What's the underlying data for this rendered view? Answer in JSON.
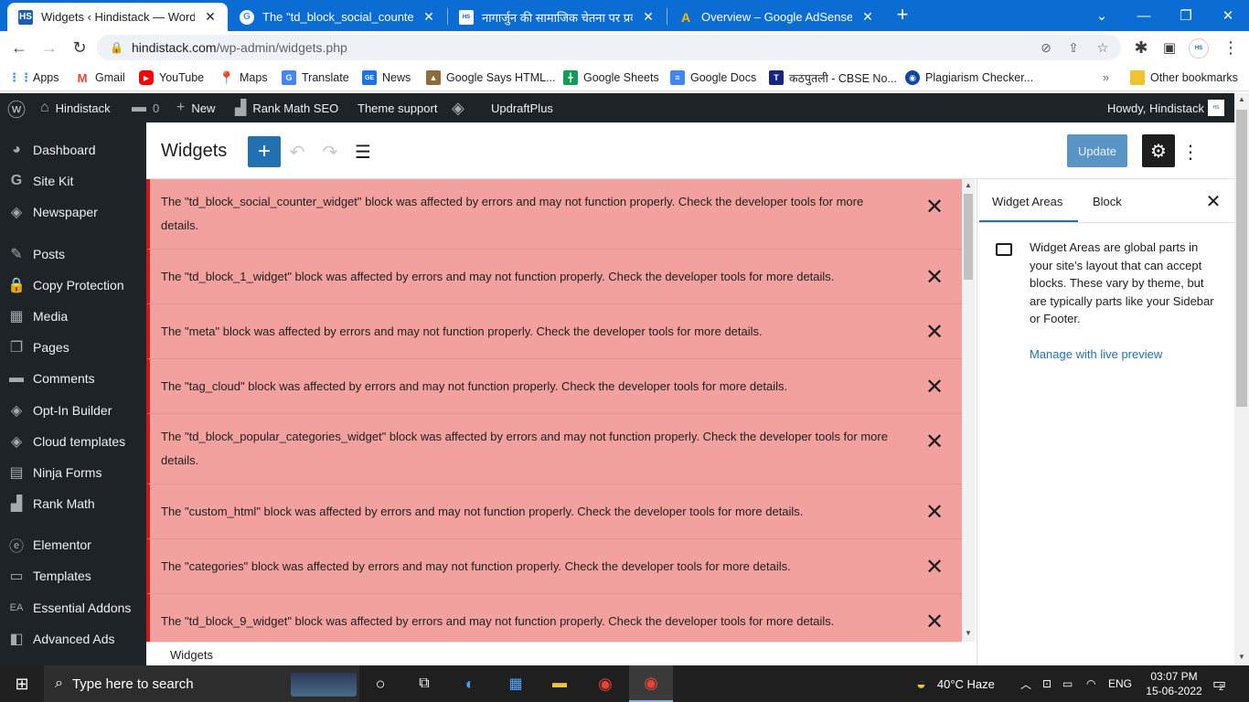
{
  "browser": {
    "tabs": [
      {
        "title": "Widgets ‹ Hindistack — WordPress",
        "favicon": "HS",
        "active": true
      },
      {
        "title": "The \"td_block_social_counter_widget\"",
        "favicon": "G",
        "active": false
      },
      {
        "title": "नागार्जुन की सामाजिक चेतना पर प्रकाश",
        "favicon": "HS",
        "active": false
      },
      {
        "title": "Overview – Google AdSense",
        "favicon": "A",
        "active": false
      }
    ],
    "url_host": "hindistack.com",
    "url_path": "/wp-admin/widgets.php",
    "profile_label": "HS",
    "bookmarks": [
      {
        "label": "Apps",
        "icon": "apps-icon",
        "color": "#4285f4"
      },
      {
        "label": "Gmail",
        "icon": "gmail-icon",
        "color": "#ea4335"
      },
      {
        "label": "YouTube",
        "icon": "youtube-icon",
        "color": "#ff0000"
      },
      {
        "label": "Maps",
        "icon": "maps-icon",
        "color": "#34a853"
      },
      {
        "label": "Translate",
        "icon": "translate-icon",
        "color": "#4285f4"
      },
      {
        "label": "News",
        "icon": "news-icon",
        "color": "#1a73e8"
      },
      {
        "label": "Google Says HTML...",
        "icon": "image-icon",
        "color": "#8a6d3b"
      },
      {
        "label": "Google Sheets",
        "icon": "sheets-icon",
        "color": "#0f9d58"
      },
      {
        "label": "Google Docs",
        "icon": "docs-icon",
        "color": "#4285f4"
      },
      {
        "label": "कठपुतली - CBSE No...",
        "icon": "site-icon",
        "color": "#1a237e"
      },
      {
        "label": "Plagiarism Checker...",
        "icon": "search-site-icon",
        "color": "#1565c0"
      }
    ],
    "other_bookmarks": "Other bookmarks",
    "overflow": "»"
  },
  "adminbar": {
    "site": "Hindistack",
    "comments_count": "0",
    "new_label": "New",
    "rankmath": "Rank Math SEO",
    "theme_support": "Theme support",
    "updraft": "UpdraftPlus",
    "howdy": "Howdy, Hindistack"
  },
  "sidebar": {
    "items": [
      {
        "label": "Dashboard",
        "icon": "dashboard-icon"
      },
      {
        "label": "Site Kit",
        "icon": "sitekit-icon"
      },
      {
        "label": "Newspaper",
        "icon": "newspaper-icon"
      },
      {
        "label": "Posts",
        "icon": "posts-icon"
      },
      {
        "label": "Copy Protection",
        "icon": "lock-icon"
      },
      {
        "label": "Media",
        "icon": "media-icon"
      },
      {
        "label": "Pages",
        "icon": "pages-icon"
      },
      {
        "label": "Comments",
        "icon": "comments-icon"
      },
      {
        "label": "Opt-In Builder",
        "icon": "optin-icon"
      },
      {
        "label": "Cloud templates",
        "icon": "cloud-icon"
      },
      {
        "label": "Ninja Forms",
        "icon": "forms-icon"
      },
      {
        "label": "Rank Math",
        "icon": "rankmath-icon"
      },
      {
        "label": "Elementor",
        "icon": "elementor-icon"
      },
      {
        "label": "Templates",
        "icon": "folder-icon"
      },
      {
        "label": "Essential Addons",
        "icon": "addons-icon"
      },
      {
        "label": "Advanced Ads",
        "icon": "ads-icon"
      }
    ]
  },
  "editor": {
    "title": "Widgets",
    "update_label": "Update",
    "breadcrumb": "Widgets"
  },
  "notices": [
    "The \"td_block_social_counter_widget\" block was affected by errors and may not function properly. Check the developer tools for more details.",
    "The \"td_block_1_widget\" block was affected by errors and may not function properly. Check the developer tools for more details.",
    "The \"meta\" block was affected by errors and may not function properly. Check the developer tools for more details.",
    "The \"tag_cloud\" block was affected by errors and may not function properly. Check the developer tools for more details.",
    "The \"td_block_popular_categories_widget\" block was affected by errors and may not function properly. Check the developer tools for more details.",
    "The \"custom_html\" block was affected by errors and may not function properly. Check the developer tools for more details.",
    "The \"categories\" block was affected by errors and may not function properly. Check the developer tools for more details.",
    "The \"td_block_9_widget\" block was affected by errors and may not function properly. Check the developer tools for more details."
  ],
  "panel": {
    "tab_widget_areas": "Widget Areas",
    "tab_block": "Block",
    "description": "Widget Areas are global parts in your site's layout that can accept blocks. These vary by theme, but are typically parts like your Sidebar or Footer.",
    "link": "Manage with live preview"
  },
  "taskbar": {
    "search_placeholder": "Type here to search",
    "weather": "40°C  Haze",
    "language": "ENG",
    "time": "03:07 PM",
    "date": "15-06-2022",
    "notification_count": "2"
  },
  "colors": {
    "chrome_blue": "#0b6cd3",
    "wp_dark": "#1d2327",
    "wp_blue": "#2271b1",
    "notice_bg": "#f2a19f",
    "notice_border": "#cc1818"
  }
}
